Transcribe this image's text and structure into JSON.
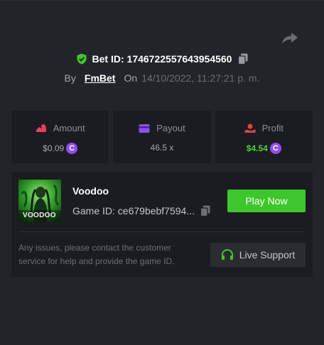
{
  "header": {
    "bet_id_label": "Bet ID: 1746722557643954560",
    "by_label": "By",
    "username": "FmBet",
    "on_label": "On",
    "date": "14/10/2022, 11:27:21 p. m."
  },
  "stats": [
    {
      "label": "Amount",
      "value": "$0.09",
      "icon": "amount-icon",
      "value_color": "#a4a6ae",
      "coin": true
    },
    {
      "label": "Payout",
      "value": "46.5 x",
      "icon": "payout-icon",
      "value_color": "#a4a6ae",
      "coin": false
    },
    {
      "label": "Profit",
      "value": "$4.54",
      "icon": "profit-icon",
      "value_color": "#4bd43c",
      "coin": true
    }
  ],
  "coin_symbol": "C",
  "game": {
    "name": "Voodoo",
    "id_label": "Game ID: ce679bebf7594...",
    "thumb_text": "VOODOO",
    "play_label": "Play Now",
    "note": "Any issues, please contact the customer service for help and provide the game ID.",
    "support_label": "Live Support"
  },
  "colors": {
    "accent_green": "#3ec72c",
    "profit_green": "#4bd43c",
    "coin_purple": "#8f4ef0",
    "amount_pink": "#e0435e",
    "payout_purple": "#8f4ef0",
    "profit_red": "#e04545",
    "background": "#232429",
    "panel": "#1b1c21"
  }
}
